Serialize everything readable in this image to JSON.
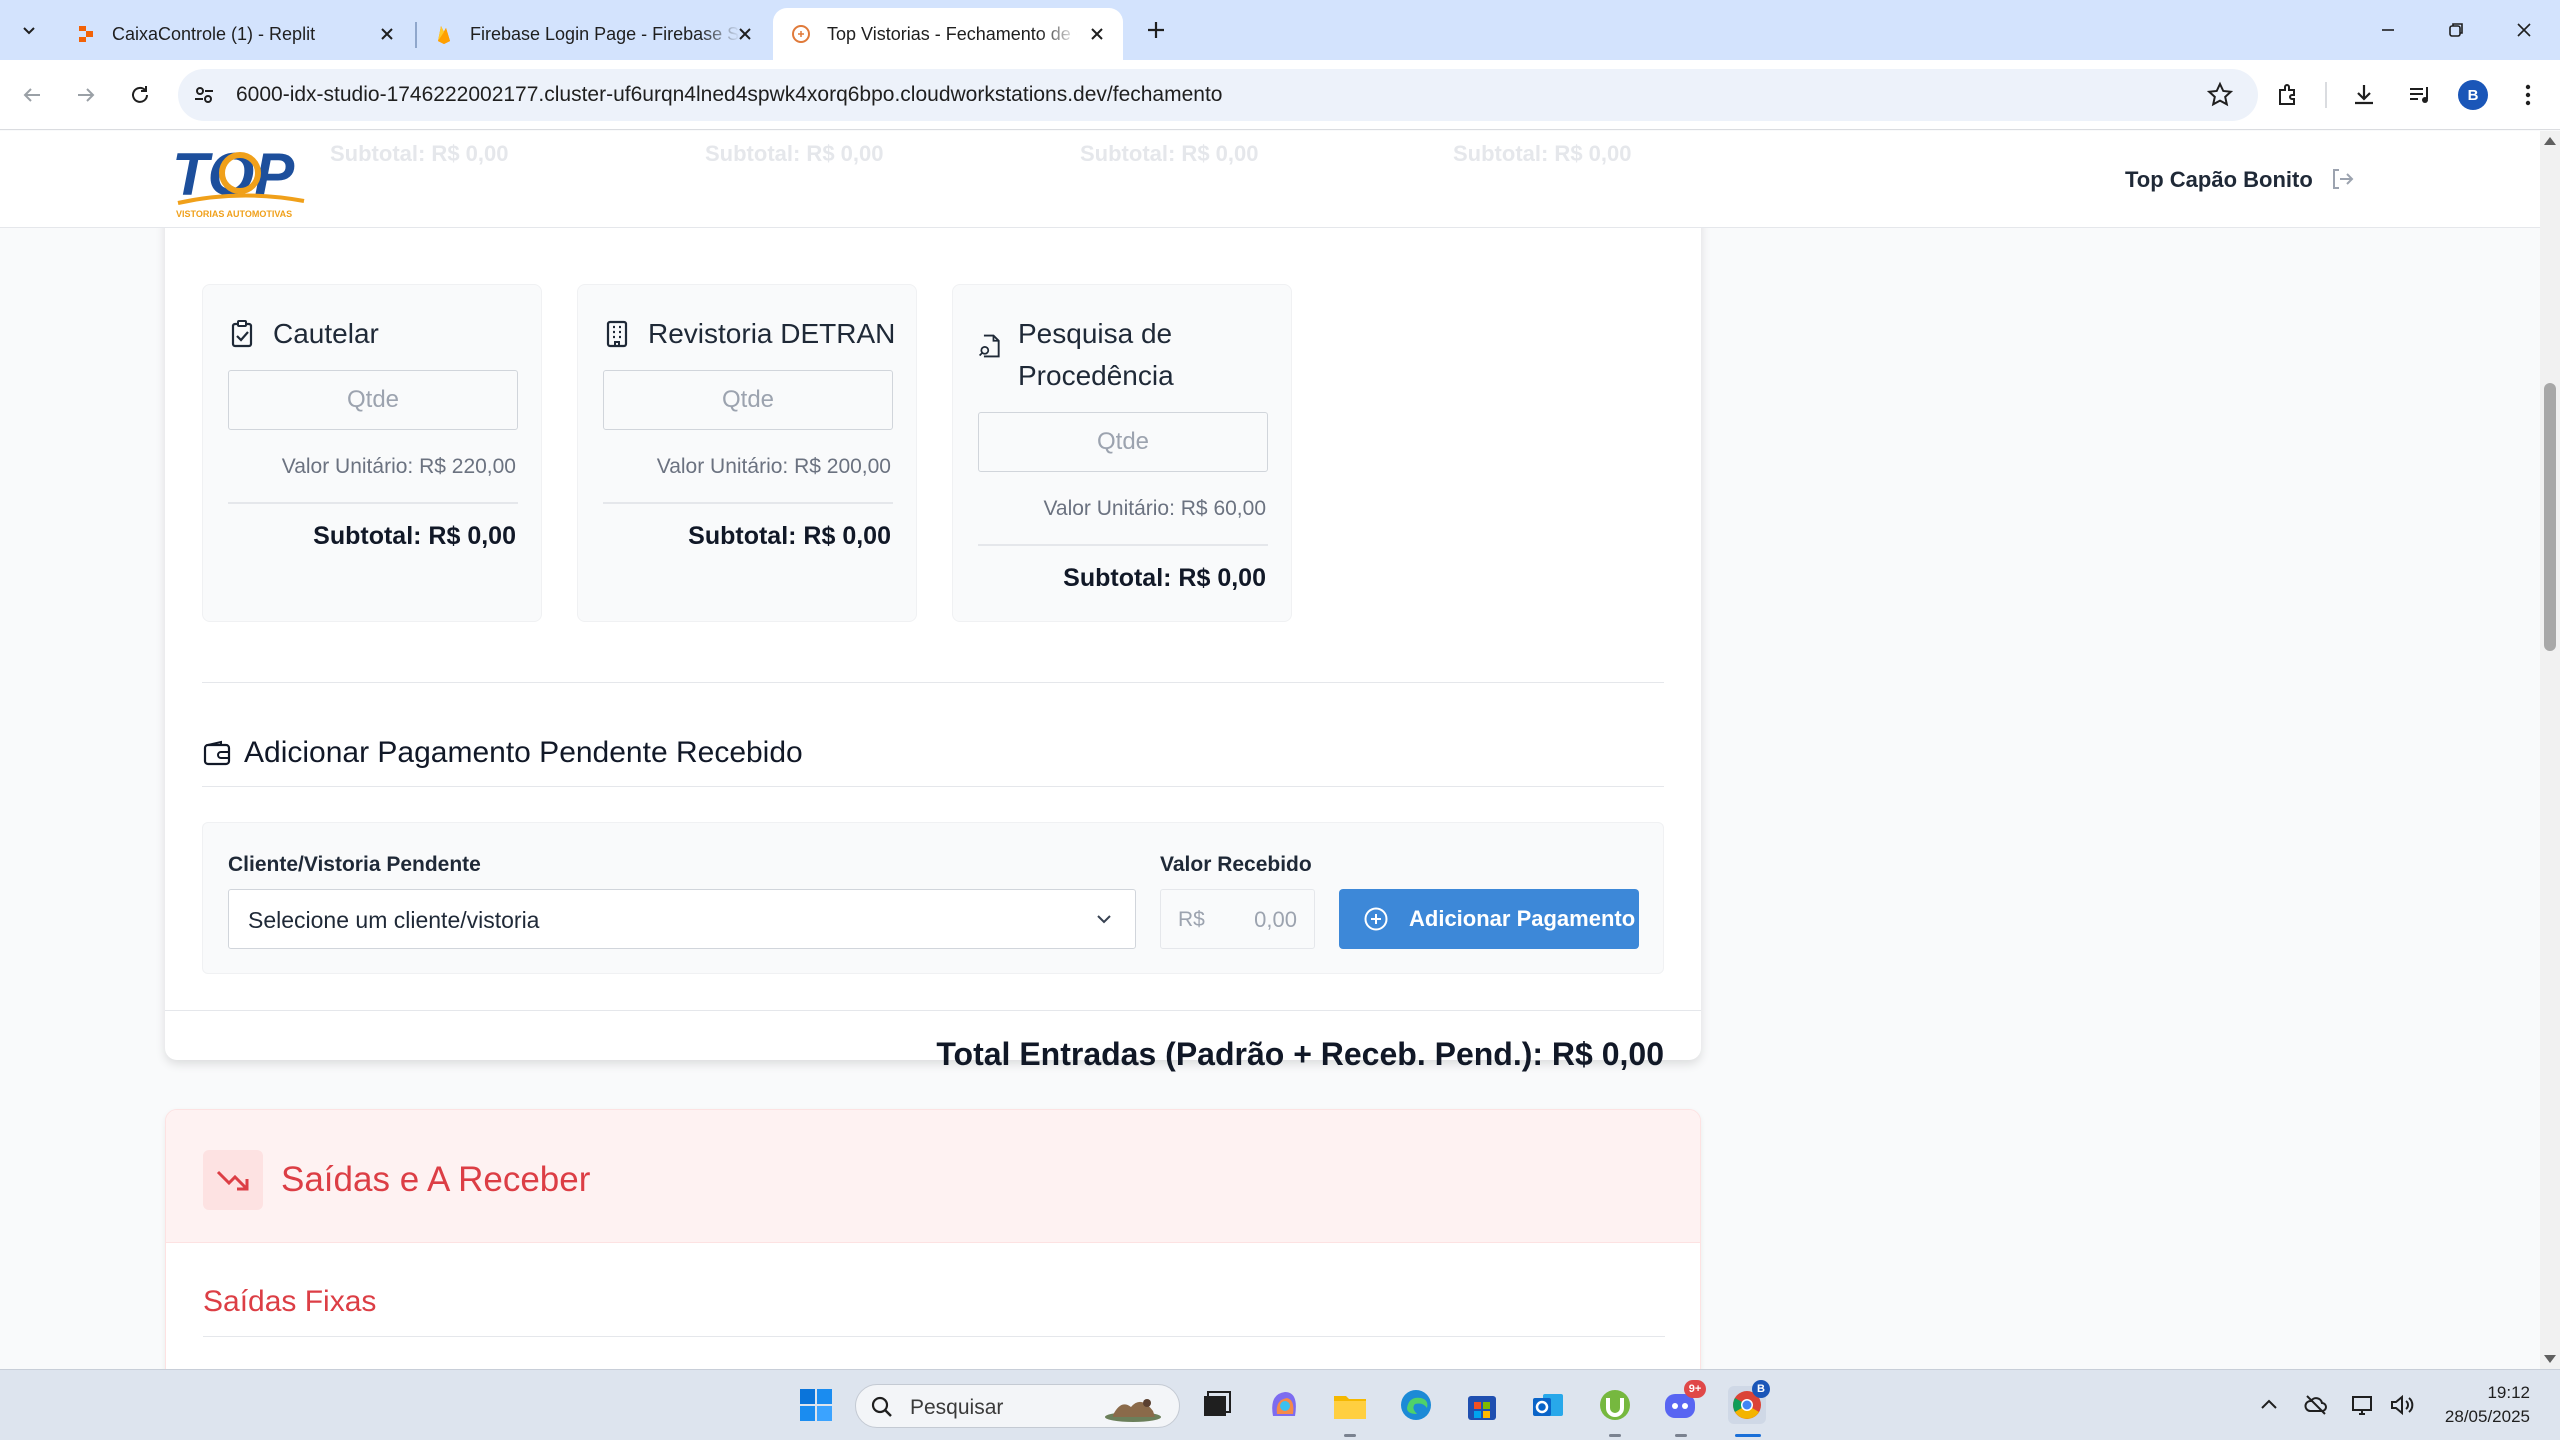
{
  "browser": {
    "tabs": [
      {
        "title": "CaixaControle (1) - Replit",
        "active": false
      },
      {
        "title": "Firebase Login Page - Firebase S",
        "active": false
      },
      {
        "title": "Top Vistorias - Fechamento de C",
        "active": true
      }
    ],
    "url": "6000-idx-studio-1746222002177.cluster-uf6urqn4lned4spwk4xorq6bpo.cloudworkstations.dev/fechamento",
    "profile_initial": "B"
  },
  "header": {
    "logo_text": "TOP",
    "logo_subtext": "VISTORIAS AUTOMOTIVAS",
    "ghost_subtotals": [
      "Subtotal: R$ 0,00",
      "Subtotal: R$ 0,00",
      "Subtotal: R$ 0,00",
      "Subtotal: R$ 0,00"
    ],
    "company": "Top Capão Bonito"
  },
  "services": [
    {
      "title": "Cautelar",
      "qty_placeholder": "Qtde",
      "unit": "Valor Unitário: R$ 220,00",
      "subtotal": "Subtotal: R$ 0,00",
      "icon": "clipboard-check-icon"
    },
    {
      "title": "Revistoria DETRAN",
      "qty_placeholder": "Qtde",
      "unit": "Valor Unitário: R$ 200,00",
      "subtotal": "Subtotal: R$ 0,00",
      "icon": "building-icon"
    },
    {
      "title": "Pesquisa de Procedência",
      "qty_placeholder": "Qtde",
      "unit": "Valor Unitário: R$ 60,00",
      "subtotal": "Subtotal: R$ 0,00",
      "icon": "file-search-icon"
    }
  ],
  "pending": {
    "title": "Adicionar Pagamento Pendente Recebido",
    "client_label": "Cliente/Vistoria Pendente",
    "client_value": "Selecione um cliente/vistoria",
    "amount_label": "Valor Recebido",
    "currency": "R$",
    "amount_placeholder": "0,00",
    "add_button": "Adicionar Pagamento"
  },
  "total": "Total Entradas (Padrão + Receb. Pend.): R$ 0,00",
  "saidas": {
    "title": "Saídas e A Receber",
    "fixas_title": "Saídas Fixas"
  },
  "taskbar": {
    "search_placeholder": "Pesquisar",
    "time": "19:12",
    "date": "28/05/2025",
    "discord_badge": "9+",
    "chrome_badge": "B"
  },
  "colors": {
    "primary": "#3d88d8",
    "danger": "#dc3e45",
    "danger_bg": "#fef2f2",
    "logo_blue": "#1d4f9c",
    "logo_orange": "#f0a01a"
  }
}
